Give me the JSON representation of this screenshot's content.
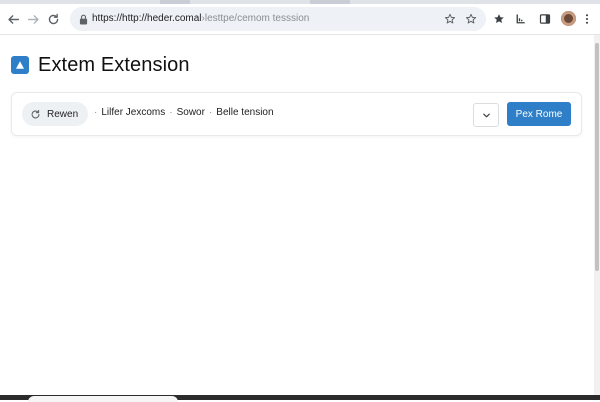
{
  "browser": {
    "url_host": "https://http://heder.comal",
    "url_path": "›lesttpe/cemom tesssion"
  },
  "icons": {
    "back": "arrow-left-icon",
    "forward": "arrow-right-icon",
    "reload": "reload-icon",
    "lock": "lock-icon",
    "bookmark_outline": "star-outline-icon",
    "bookmark_outline_2": "star-outline-icon",
    "bookmarks_filled": "star-filled-icon",
    "extensions": "chart-icon",
    "side_panel": "side-panel-icon",
    "menu": "kebab-menu-icon",
    "app_logo": "triangle-logo-icon",
    "chip_refresh": "refresh-icon",
    "dropdown": "chevron-down-icon"
  },
  "page": {
    "title": "Extem Extension"
  },
  "toolbar": {
    "chip_label": "Rewen",
    "filters": [
      "Lilfer Jexcoms",
      "Sowor",
      "Belle tension"
    ],
    "separator": "·",
    "primary_label": "Pex Rome"
  },
  "colors": {
    "accent": "#2f7fc8",
    "omnibox_bg": "#eef1f5",
    "chip_bg": "#eef1f4"
  }
}
